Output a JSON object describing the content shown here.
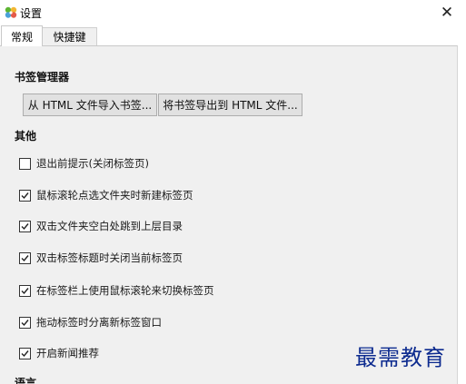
{
  "window": {
    "title": "设置",
    "icon": "clover-icon",
    "close_glyph": "✕"
  },
  "tabs": [
    {
      "label": "常规",
      "active": true
    },
    {
      "label": "快捷键",
      "active": false
    }
  ],
  "bookmark_manager": {
    "title": "书签管理器",
    "import_button": "从 HTML 文件导入书签...",
    "export_button": "将书签导出到 HTML 文件..."
  },
  "other": {
    "title": "其他",
    "options": [
      {
        "label": "退出前提示(关闭标签页)",
        "checked": false
      },
      {
        "label": "鼠标滚轮点选文件夹时新建标签页",
        "checked": true
      },
      {
        "label": "双击文件夹空白处跳到上层目录",
        "checked": true
      },
      {
        "label": "双击标签标题时关闭当前标签页",
        "checked": true
      },
      {
        "label": "在标签栏上使用鼠标滚轮来切换标签页",
        "checked": true
      },
      {
        "label": "拖动标签时分离新标签窗口",
        "checked": true
      },
      {
        "label": "开启新闻推荐",
        "checked": true
      }
    ]
  },
  "language": {
    "title": "语言"
  },
  "watermark": "最需教育",
  "colors": {
    "panel_bg": "#f0f0f0",
    "button_bg": "#e1e1e1",
    "watermark": "#0d2b8f"
  }
}
